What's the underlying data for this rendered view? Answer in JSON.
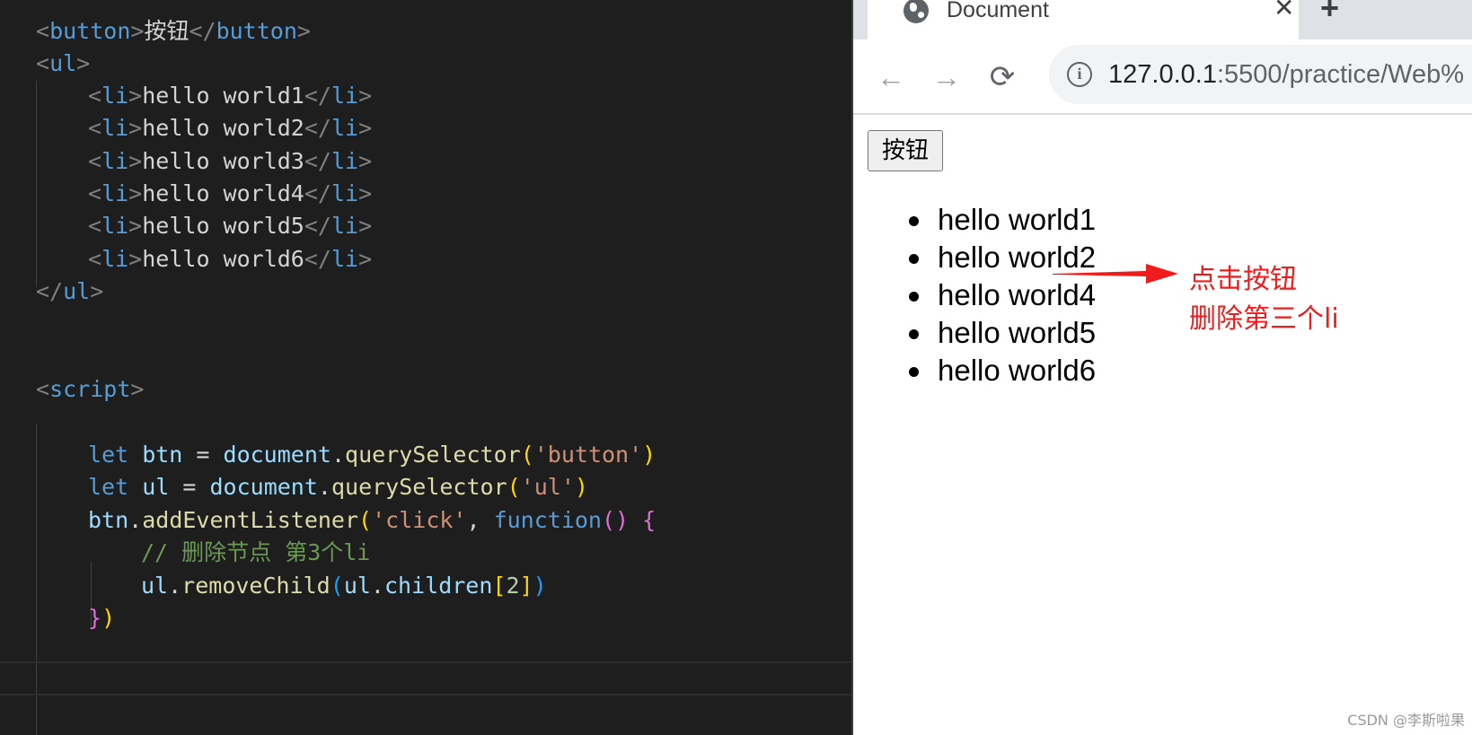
{
  "editor": {
    "lines": {
      "l1": [
        "<",
        "button",
        ">",
        "按钮",
        "</",
        "button",
        ">"
      ],
      "l2": [
        "<",
        "ul",
        ">"
      ],
      "li": [
        [
          "<",
          "li",
          ">",
          "hello world1",
          "</",
          "li",
          ">"
        ],
        [
          "<",
          "li",
          ">",
          "hello world2",
          "</",
          "li",
          ">"
        ],
        [
          "<",
          "li",
          ">",
          "hello world3",
          "</",
          "li",
          ">"
        ],
        [
          "<",
          "li",
          ">",
          "hello world4",
          "</",
          "li",
          ">"
        ],
        [
          "<",
          "li",
          ">",
          "hello world5",
          "</",
          "li",
          ">"
        ],
        [
          "<",
          "li",
          ">",
          "hello world6",
          "</",
          "li",
          ">"
        ]
      ],
      "l9": [
        "</",
        "ul",
        ">"
      ],
      "l12": [
        "<",
        "script",
        ">"
      ],
      "l14": [
        "let",
        " btn ",
        "= ",
        "document",
        ".",
        "querySelector",
        "(",
        "'button'",
        ")"
      ],
      "l15": [
        "let",
        " ul ",
        "= ",
        "document",
        ".",
        "querySelector",
        "(",
        "'ul'",
        ")"
      ],
      "l16": [
        "btn",
        ".",
        "addEventListener",
        "(",
        "'click'",
        ", ",
        "function",
        "()",
        " ",
        "{"
      ],
      "l17": [
        "// 删除节点 第3个li"
      ],
      "l18": [
        "ul",
        ".",
        "removeChild",
        "(",
        "ul",
        ".",
        "children",
        "[",
        "2",
        "]",
        ")"
      ],
      "l19": [
        "}",
        ")"
      ]
    }
  },
  "browser": {
    "tab_title": "Document",
    "tab_close": "✕",
    "new_tab": "+",
    "back_icon": "←",
    "forward_icon": "→",
    "reload_icon": "⟳",
    "info_icon": "i",
    "url_host": "127.0.0.1",
    "url_rest": ":5500/practice/Web%",
    "page_button": "按钮",
    "list_items": [
      "hello world1",
      "hello world2",
      "hello world4",
      "hello world5",
      "hello world6"
    ],
    "annotation_line1": "点击按钮",
    "annotation_line2": "删除第三个li",
    "annotation_color": "#ee1c1c",
    "watermark": "CSDN @李斯啦果"
  }
}
